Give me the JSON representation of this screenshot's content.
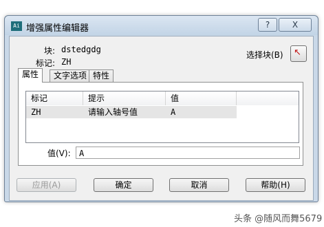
{
  "window": {
    "title": "增强属性编辑器",
    "app_icon_text": "Ai",
    "help_label": "?",
    "close_label": "X"
  },
  "block": {
    "block_label": "块:",
    "block_name": "dstedgdg",
    "tag_label": "标记:",
    "tag_value": "ZH",
    "select_block_label": "选择块(B)"
  },
  "tabs": [
    {
      "label": "属性",
      "active": true
    },
    {
      "label": "文字选项",
      "active": false
    },
    {
      "label": "特性",
      "active": false
    }
  ],
  "table": {
    "columns": [
      "标记",
      "提示",
      "值"
    ],
    "rows": [
      {
        "tag": "ZH",
        "prompt": "请输入轴号值",
        "value": "A"
      }
    ]
  },
  "value_field": {
    "label": "值(V):",
    "value": "A"
  },
  "buttons": {
    "apply": "应用(A)",
    "ok": "确定",
    "cancel": "取消",
    "help": "帮助(H)"
  },
  "watermark": "头条 @随风而舞5679"
}
